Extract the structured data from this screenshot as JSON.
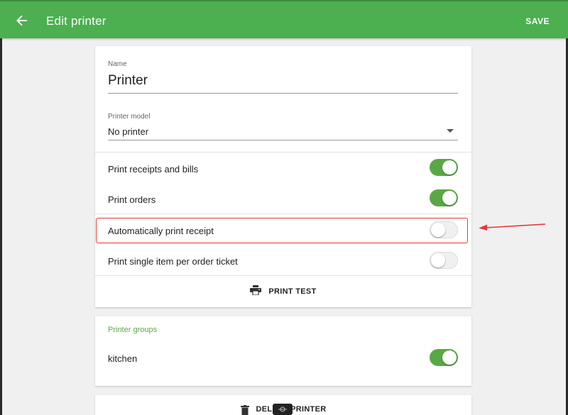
{
  "appbar": {
    "title": "Edit printer",
    "save_label": "SAVE",
    "color": "#4caf50"
  },
  "form": {
    "name": {
      "label": "Name",
      "value": "Printer"
    },
    "model": {
      "label": "Printer model",
      "value": "No printer"
    }
  },
  "toggles": [
    {
      "label": "Print receipts and bills",
      "on": true
    },
    {
      "label": "Print orders",
      "on": true
    },
    {
      "label": "Automatically print receipt",
      "on": false
    },
    {
      "label": "Print single item per order ticket",
      "on": false
    }
  ],
  "print_test_label": "PRINT TEST",
  "groups": {
    "title": "Printer groups",
    "items": [
      {
        "label": "kitchen",
        "on": true
      }
    ]
  },
  "delete_label": "DELETE PRINTER",
  "annotation_color": "#e53935",
  "accent_color": "#5aa845"
}
